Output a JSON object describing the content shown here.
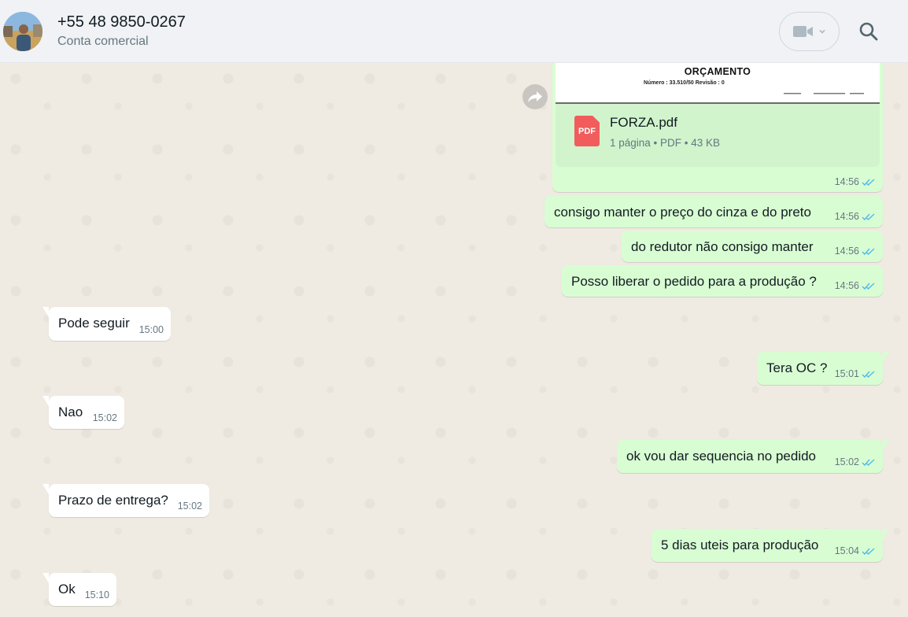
{
  "header": {
    "contact_name": "+55 48 9850-0267",
    "contact_subtitle": "Conta comercial",
    "icons": [
      "avatar",
      "video-call-icon",
      "chevron-down-icon",
      "search-icon"
    ]
  },
  "document": {
    "preview_title": "ORÇAMENTO",
    "preview_line": "Número :       33.510/50             Revisão :      0",
    "file_name": "FORZA.pdf",
    "file_info": "1 página • PDF • 43 KB",
    "file_icon_label": "PDF",
    "time": "14:56"
  },
  "messages": [
    {
      "direction": "out",
      "text": "consigo manter o preço do cinza e do preto",
      "time": "14:56"
    },
    {
      "direction": "out",
      "text": "do redutor não consigo manter",
      "time": "14:56"
    },
    {
      "direction": "out",
      "text": "Posso liberar o pedido para a produção ?",
      "time": "14:56"
    },
    {
      "direction": "in",
      "text": "Pode seguir",
      "time": "15:00"
    },
    {
      "direction": "out",
      "text": "Tera OC ?",
      "time": "15:01"
    },
    {
      "direction": "in",
      "text": "Nao",
      "time": "15:02"
    },
    {
      "direction": "out",
      "text": "ok vou dar sequencia no pedido",
      "time": "15:02"
    },
    {
      "direction": "in",
      "text": "Prazo de entrega?",
      "time": "15:02"
    },
    {
      "direction": "out",
      "text": "5 dias uteis para produção",
      "time": "15:04"
    },
    {
      "direction": "in",
      "text": "Ok",
      "time": "15:10"
    }
  ],
  "colors": {
    "outgoing_bubble": "#d9fdd3",
    "incoming_bubble": "#ffffff",
    "read_ticks": "#53bdeb",
    "chat_background": "#efeae2"
  }
}
